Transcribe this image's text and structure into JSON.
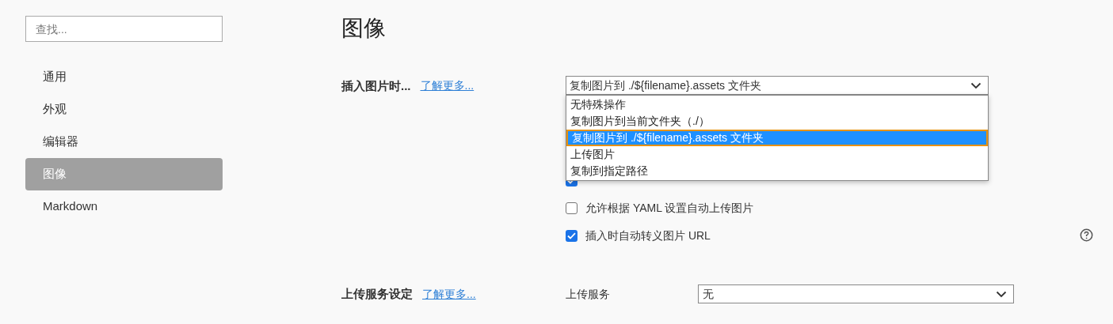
{
  "sidebar": {
    "search": {
      "placeholder": "查找..."
    },
    "items": [
      {
        "label": "通用",
        "selected": false
      },
      {
        "label": "外观",
        "selected": false
      },
      {
        "label": "编辑器",
        "selected": false
      },
      {
        "label": "图像",
        "selected": true
      },
      {
        "label": "Markdown",
        "selected": false
      }
    ]
  },
  "page_title": "图像",
  "insert_section": {
    "label": "插入图片时...",
    "link": "了解更多...",
    "select": {
      "value": "复制图片到 ./${filename}.assets 文件夹",
      "expanded": true,
      "options": [
        {
          "label": "无特殊操作",
          "selected": false
        },
        {
          "label": "复制图片到当前文件夹（./）",
          "selected": false
        },
        {
          "label": "复制图片到 ./${filename}.assets 文件夹",
          "selected": true
        },
        {
          "label": "上传图片",
          "selected": false
        },
        {
          "label": "复制到指定路径",
          "selected": false
        }
      ]
    },
    "options": [
      {
        "checked": true
      },
      {
        "label": "允许根据 YAML 设置自动上传图片",
        "checked": false
      },
      {
        "label": "插入时自动转义图片 URL",
        "checked": true,
        "help": true
      }
    ]
  },
  "upload_section": {
    "label": "上传服务设定",
    "link": "了解更多...",
    "field_label": "上传服务",
    "select": {
      "value": "无"
    }
  }
}
